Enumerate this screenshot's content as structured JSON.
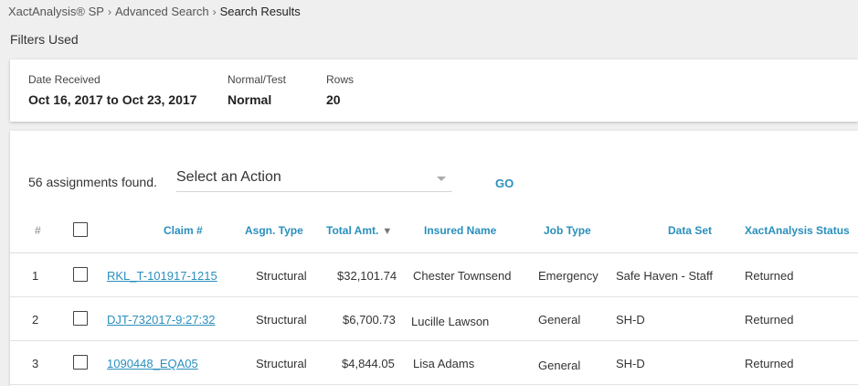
{
  "breadcrumb": {
    "items": [
      "XactAnalysis® SP",
      "Advanced Search",
      "Search Results"
    ]
  },
  "filters": {
    "title": "Filters Used",
    "items": [
      {
        "label": "Date Received",
        "value": "Oct 16, 2017 to Oct 23, 2017"
      },
      {
        "label": "Normal/Test",
        "value": "Normal"
      },
      {
        "label": "Rows",
        "value": "20"
      }
    ]
  },
  "results": {
    "count_text": "56 assignments found.",
    "action_select": {
      "value": "Select an Action"
    },
    "go_label": "GO",
    "columns": [
      "#",
      "Claim #",
      "Asgn. Type",
      "Total Amt.",
      "Insured Name",
      "Job Type",
      "Data Set",
      "XactAnalysis Status"
    ],
    "sort_column": "Total Amt.",
    "sort_direction": "descending",
    "rows": [
      {
        "num": "1",
        "claim": "RKL_T-101917-1215",
        "asgn_type": "Structural",
        "total": "$32,101.74",
        "insured": "Chester Townsend",
        "job_type": "Emergency",
        "data_set": "Safe Haven - Staff",
        "status": "Returned",
        "checked": false
      },
      {
        "num": "2",
        "claim": "DJT-732017-9:27:32",
        "asgn_type": "Structural",
        "total": "$6,700.73",
        "insured": "Lucille Lawson",
        "job_type": "General",
        "data_set": "SH-D",
        "status": "Returned",
        "checked": false
      },
      {
        "num": "3",
        "claim": "1090448_EQA05",
        "asgn_type": "Structural",
        "total": "$4,844.05",
        "insured": "Lisa Adams",
        "job_type": "General",
        "data_set": "SH-D",
        "status": "Returned",
        "checked": false
      }
    ]
  },
  "colors": {
    "accent": "#2a8fbd",
    "background": "#efefef",
    "card": "#ffffff"
  }
}
